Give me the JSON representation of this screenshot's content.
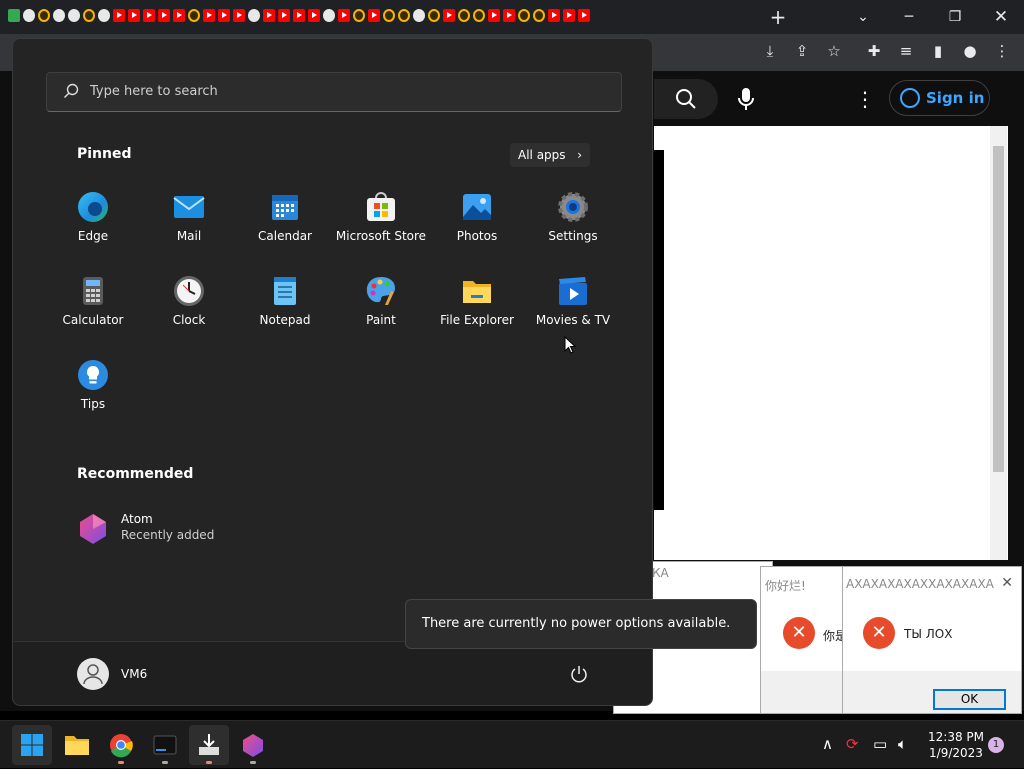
{
  "browser": {
    "new_tab_label": "+",
    "signin_label": "Sign in"
  },
  "start_menu": {
    "search_placeholder": "Type here to search",
    "pinned_title": "Pinned",
    "all_apps_label": "All apps",
    "pinned_apps": [
      {
        "label": "Edge",
        "icon": "edge-icon"
      },
      {
        "label": "Mail",
        "icon": "mail-icon"
      },
      {
        "label": "Calendar",
        "icon": "calendar-icon"
      },
      {
        "label": "Microsoft Store",
        "icon": "store-icon"
      },
      {
        "label": "Photos",
        "icon": "photos-icon"
      },
      {
        "label": "Settings",
        "icon": "settings-icon"
      },
      {
        "label": "Calculator",
        "icon": "calculator-icon"
      },
      {
        "label": "Clock",
        "icon": "clock-icon"
      },
      {
        "label": "Notepad",
        "icon": "notepad-icon"
      },
      {
        "label": "Paint",
        "icon": "paint-icon"
      },
      {
        "label": "File Explorer",
        "icon": "folder-icon"
      },
      {
        "label": "Movies & TV",
        "icon": "movies-icon"
      },
      {
        "label": "Tips",
        "icon": "tips-icon"
      }
    ],
    "recommended_title": "Recommended",
    "recommended": [
      {
        "name": "Atom",
        "subtitle": "Recently added",
        "icon": "atom-icon"
      }
    ],
    "user_name": "VM6"
  },
  "toast": {
    "message": "There are currently no power options available."
  },
  "dialogs": [
    {
      "title": "КА"
    },
    {
      "title": "你好烂!",
      "message": "你是"
    },
    {
      "title": "АХАХАХАХАХХАХАХАХА",
      "message": "ТЫ ЛОХ",
      "ok_label": "OK"
    }
  ],
  "taskbar": {
    "time": "12:38 PM",
    "date": "1/9/2023",
    "notification_count": "1"
  },
  "colors": {
    "start_bg": "#242424",
    "accent": "#0078d4",
    "error_red": "#e84a2c",
    "youtube_blue": "#3ea6ff"
  }
}
